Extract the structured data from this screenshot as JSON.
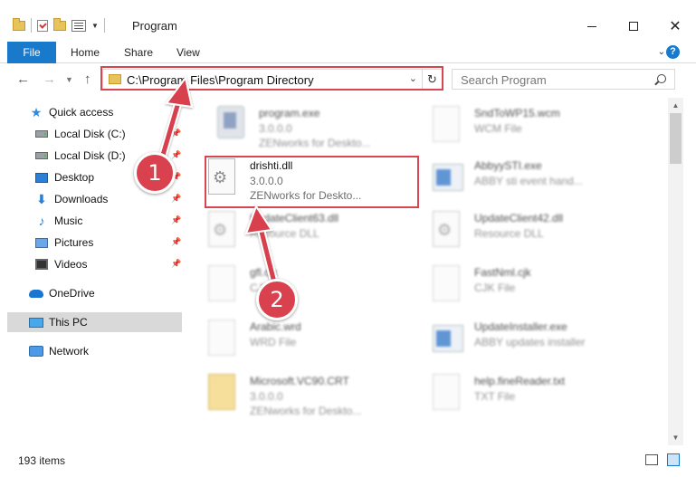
{
  "window": {
    "title": "Program"
  },
  "ribbon": {
    "file": "File",
    "home": "Home",
    "share": "Share",
    "view": "View"
  },
  "nav": {
    "address": "C:\\Program Files\\Program Directory",
    "search_placeholder": "Search Program"
  },
  "sidebar": {
    "items": [
      {
        "label": "Quick access"
      },
      {
        "label": "Local Disk (C:)"
      },
      {
        "label": "Local Disk (D:)"
      },
      {
        "label": "Desktop"
      },
      {
        "label": "Downloads"
      },
      {
        "label": "Music"
      },
      {
        "label": "Pictures"
      },
      {
        "label": "Videos"
      },
      {
        "label": "OneDrive"
      },
      {
        "label": "This PC"
      },
      {
        "label": "Network"
      }
    ]
  },
  "files": [
    {
      "name": "program.exe",
      "line2": "3.0.0.0",
      "line3": "ZENworks for Deskto..."
    },
    {
      "name": "SndToWP15.wcm",
      "line2": "WCM File",
      "line3": ""
    },
    {
      "name": "drishti.dll",
      "line2": "3.0.0.0",
      "line3": "ZENworks for Deskto..."
    },
    {
      "name": "AbbyySTI.exe",
      "line2": "ABBY sti event hand...",
      "line3": ""
    },
    {
      "name": "UpdateClient63.dll",
      "line2": "Resource DLL",
      "line3": ""
    },
    {
      "name": "UpdateClient42.dll",
      "line2": "Resource DLL",
      "line3": ""
    },
    {
      "name": "gfl.cjk",
      "line2": "CJK File",
      "line3": ""
    },
    {
      "name": "FastNml.cjk",
      "line2": "CJK File",
      "line3": ""
    },
    {
      "name": "Arabic.wrd",
      "line2": "WRD File",
      "line3": ""
    },
    {
      "name": "UpdateInstaller.exe",
      "line2": "ABBY updates installer",
      "line3": ""
    },
    {
      "name": "Microsoft.VC90.CRT",
      "line2": "3.0.0.0",
      "line3": "ZENworks for Deskto..."
    },
    {
      "name": "help.fineReader.txt",
      "line2": "TXT File",
      "line3": ""
    }
  ],
  "status": {
    "count": "193 items"
  },
  "callouts": {
    "one": "1",
    "two": "2"
  },
  "colors": {
    "accent": "#1979ca",
    "highlight": "#d64550",
    "badge": "#d9414e"
  }
}
